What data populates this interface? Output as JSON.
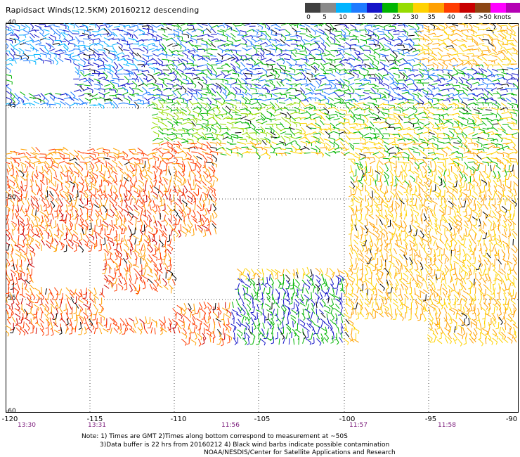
{
  "title": "Rapidsact Winds(12.5KM) 20160212 descending",
  "legend": {
    "labels": [
      "0",
      "5",
      "10",
      "15",
      "20",
      "25",
      "30",
      "35",
      "40",
      "45",
      ">50 knots"
    ],
    "colors": [
      "#404040",
      "#8a8a8a",
      "#00b4ff",
      "#1e7bff",
      "#1414c8",
      "#00b400",
      "#96dc00",
      "#ffd200",
      "#ffa000",
      "#ff3c00",
      "#c80000",
      "#8b4513",
      "#ff00ff",
      "#b400b4"
    ]
  },
  "axes": {
    "lat_labels": [
      "-40",
      "-45",
      "-50",
      "-55",
      "-60"
    ],
    "lon_labels": [
      "-120",
      "-115",
      "-110",
      "-105",
      "-100",
      "-95",
      "-90"
    ],
    "time_labels": [
      "13:30",
      "13:31",
      "11:56",
      "11:57",
      "11:58"
    ]
  },
  "notes": {
    "line1": "Note: 1) Times are GMT 2)Times along bottom correspond to measurement at ~50S",
    "line2": "3)Data buffer is 22 hrs from 20160212 4) Black wind barbs indicate possible contamination",
    "line3": "NOAA/NESDIS/Center for Satellite Applications and Research"
  }
}
